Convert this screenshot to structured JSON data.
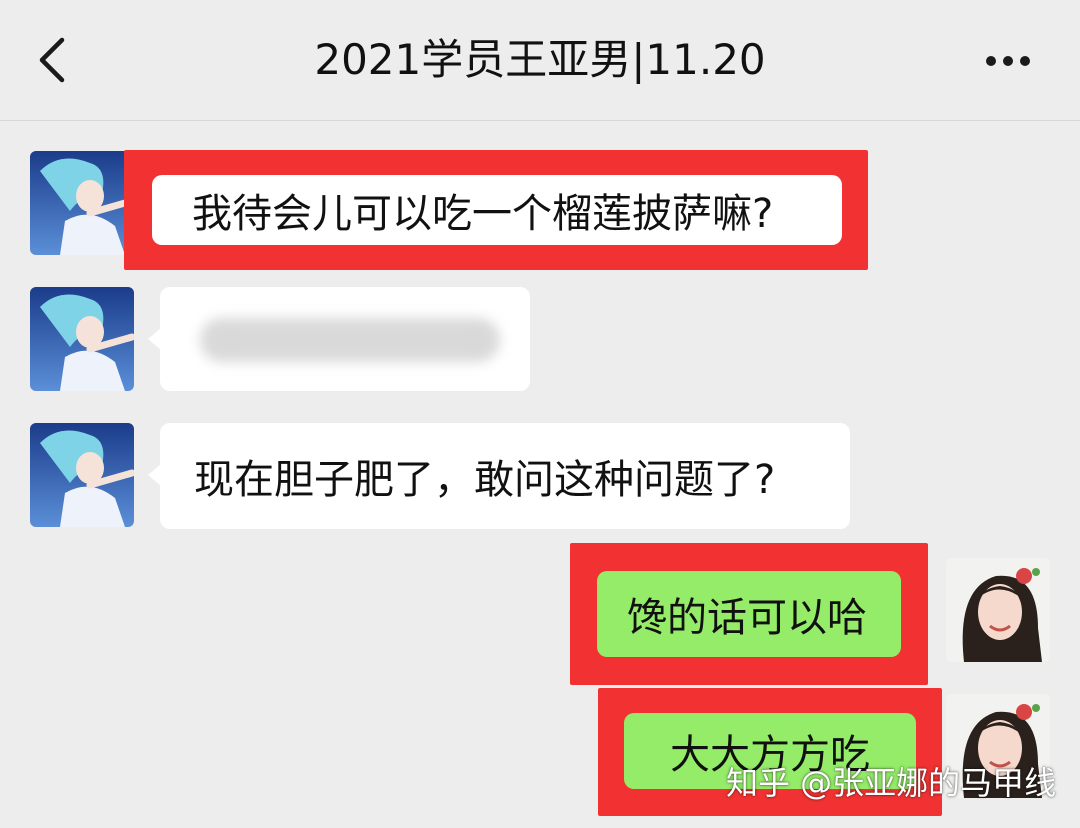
{
  "header": {
    "title": "2021学员王亚男|11.20",
    "back_icon": "back-arrow-icon",
    "more_icon": "more-dots-icon"
  },
  "messages": [
    {
      "side": "left",
      "text": "我待会儿可以吃一个榴莲披萨嘛?",
      "highlighted": true
    },
    {
      "side": "left",
      "text": "",
      "blurred": true
    },
    {
      "side": "left",
      "text": "现在胆子肥了，敢问这种问题了?",
      "highlighted": false
    },
    {
      "side": "right",
      "text": "馋的话可以哈",
      "highlighted": true
    },
    {
      "side": "right",
      "text": "大大方方吃",
      "highlighted": true
    }
  ],
  "watermark": "知乎 @张亚娜的马甲线",
  "colors": {
    "background": "#ededed",
    "bubble_in": "#ffffff",
    "bubble_out": "#95ec69",
    "highlight": "#f23232"
  }
}
